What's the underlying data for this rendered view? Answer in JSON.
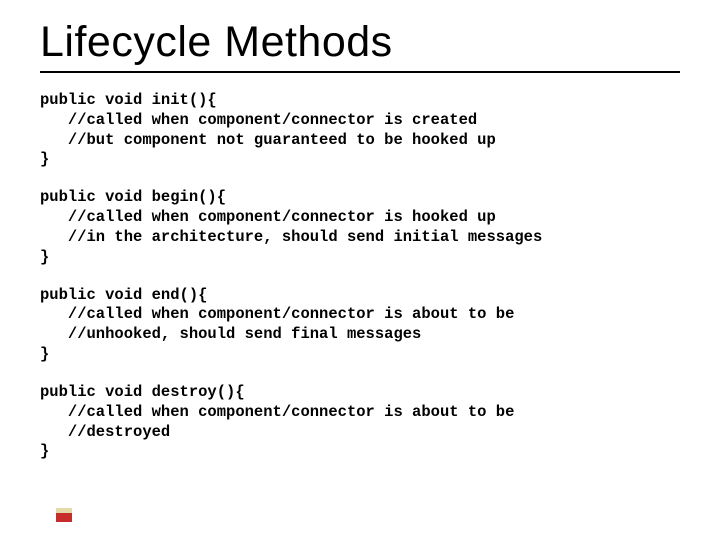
{
  "title": "Lifecycle Methods",
  "code": {
    "init": "public void init(){\n   //called when component/connector is created\n   //but component not guaranteed to be hooked up\n}",
    "begin": "public void begin(){\n   //called when component/connector is hooked up\n   //in the architecture, should send initial messages\n}",
    "end": "public void end(){\n   //called when component/connector is about to be\n   //unhooked, should send final messages\n}",
    "destroy": "public void destroy(){\n   //called when component/connector is about to be\n   //destroyed\n}"
  }
}
